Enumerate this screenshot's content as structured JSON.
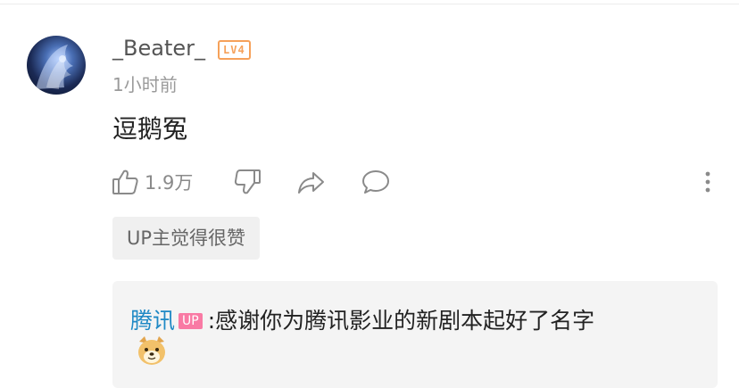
{
  "comment": {
    "username": "_Beater_",
    "level": "LV4",
    "timestamp": "1小时前",
    "text": "逗鹅冤",
    "like_count": "1.9万"
  },
  "actions": {
    "like_icon": "thumb-up-icon",
    "dislike_icon": "thumb-down-icon",
    "share_icon": "share-arrow-icon",
    "reply_icon": "comment-bubble-icon",
    "more_icon": "more-vertical-icon"
  },
  "badge": {
    "up_liked": "UP主觉得很赞"
  },
  "reply": {
    "author": "腾讯",
    "up_tag": "UP",
    "separator": ":",
    "text": "感谢你为腾讯影业的新剧本起好了名字",
    "emoji": "doge-emoji"
  },
  "colors": {
    "level_badge": "#f6a15a",
    "reply_author": "#1f89c5",
    "up_tag": "#f97aa4"
  }
}
